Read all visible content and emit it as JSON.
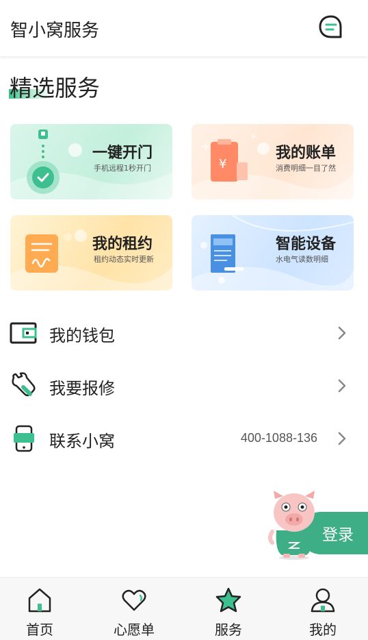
{
  "header": {
    "title": "智小窝服务",
    "message_icon": "chat-bubble-icon"
  },
  "section": {
    "title": "精选服务"
  },
  "cards": [
    {
      "title": "一键开门",
      "subtitle": "手机远程1秒开门",
      "icon": "lock-check-icon",
      "accent": "#3dbf90"
    },
    {
      "title": "我的账单",
      "subtitle": "消费明细一目了然",
      "icon": "clipboard-yen-icon",
      "accent": "#ff8a65"
    },
    {
      "title": "我的租约",
      "subtitle": "租约动态实时更新",
      "icon": "contract-icon",
      "accent": "#ffa94d"
    },
    {
      "title": "智能设备",
      "subtitle": "水电气读数明细",
      "icon": "meter-icon",
      "accent": "#4a90e2"
    }
  ],
  "list": [
    {
      "label": "我的钱包",
      "value": "",
      "icon": "wallet-icon"
    },
    {
      "label": "我要报修",
      "value": "",
      "icon": "wrench-icon"
    },
    {
      "label": "联系小窝",
      "value": "400-1088-136",
      "icon": "phone-icon"
    }
  ],
  "login": {
    "label": "登录",
    "color": "#3dae86"
  },
  "nav": [
    {
      "label": "首页",
      "icon": "home-icon"
    },
    {
      "label": "心愿单",
      "icon": "heart-icon"
    },
    {
      "label": "服务",
      "icon": "star-icon"
    },
    {
      "label": "我的",
      "icon": "user-icon"
    }
  ]
}
